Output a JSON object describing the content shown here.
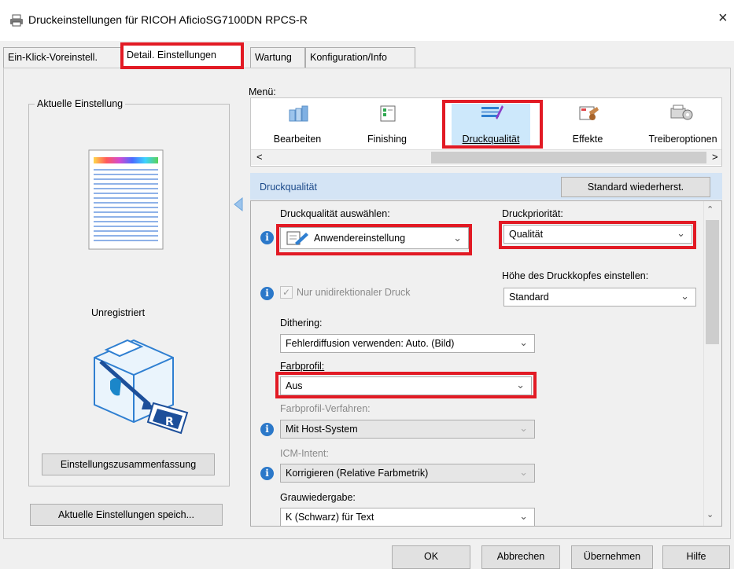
{
  "window": {
    "title": "Druckeinstellungen für RICOH AficioSG7100DN RPCS-R",
    "close_glyph": "×"
  },
  "tabs": [
    {
      "label": "Ein-Klick-Voreinstell."
    },
    {
      "label": "Detail. Einstellungen"
    },
    {
      "label": "Wartung"
    },
    {
      "label": "Konfiguration/Info"
    }
  ],
  "left_panel": {
    "group_title": "Aktuelle Einstellung",
    "status": "Unregistriert",
    "summary_button": "Einstellungszusammenfassung",
    "save_button": "Aktuelle Einstellungen speich..."
  },
  "menu": {
    "label": "Menü:",
    "items": [
      {
        "label": "Bearbeiten",
        "icon": "edit-pages-icon"
      },
      {
        "label": "Finishing",
        "icon": "finishing-icon"
      },
      {
        "label": "Druckqualität",
        "icon": "print-quality-icon"
      },
      {
        "label": "Effekte",
        "icon": "effects-stamp-icon"
      },
      {
        "label": "Treiberoptionen",
        "icon": "driver-options-icon"
      }
    ],
    "scroll_left": "<",
    "scroll_right": ">"
  },
  "section": {
    "title": "Druckqualität",
    "reset_button": "Standard wiederherst."
  },
  "settings": {
    "quality_label": "Druckqualität auswählen:",
    "quality_value": "Anwendereinstellung",
    "priority_label": "Druckpriorität:",
    "priority_value": "Qualität",
    "unidirectional_label": "Nur unidirektionaler Druck",
    "head_height_label": "Höhe des Druckkopfes einstellen:",
    "head_height_value": "Standard",
    "dithering_label": "Dithering:",
    "dithering_value": "Fehlerdiffusion verwenden: Auto. (Bild)",
    "color_profile_label": "Farbprofil:",
    "color_profile_value": "Aus",
    "profile_method_label": "Farbprofil-Verfahren:",
    "profile_method_value": "Mit Host-System",
    "icm_label": "ICM-Intent:",
    "icm_value": "Korrigieren (Relative Farbmetrik)",
    "gray_label": "Grauwiedergabe:",
    "gray_value": "K (Schwarz) für Text"
  },
  "footer": {
    "ok": "OK",
    "cancel": "Abbrechen",
    "apply": "Übernehmen",
    "help": "Hilfe"
  },
  "colors": {
    "highlight_red": "#e21a24",
    "section_blue": "#d4e4f5",
    "info_blue": "#2b78c9"
  }
}
